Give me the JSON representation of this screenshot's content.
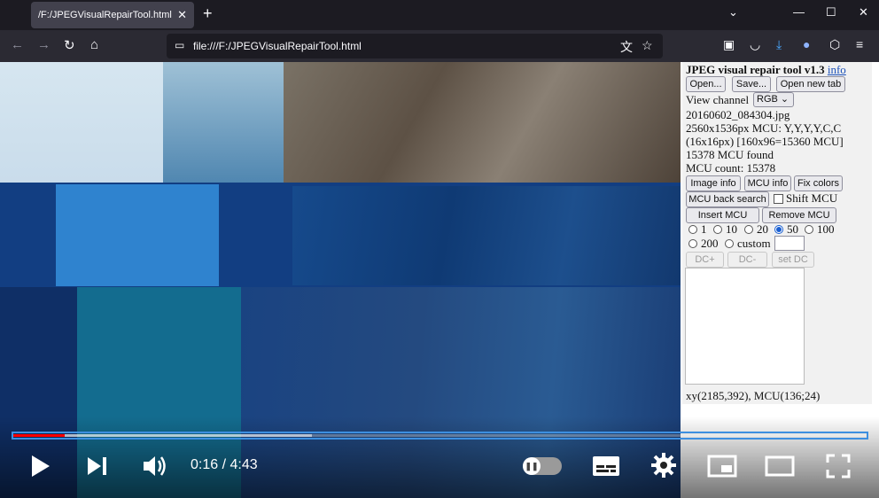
{
  "browser": {
    "tab_title": "/F:/JPEGVisualRepairTool.html",
    "url": "file:///F:/JPEGVisualRepairTool.html"
  },
  "tool": {
    "title": "JPEG visual repair tool v1.3",
    "info_link": "info",
    "open_button": "Open...",
    "save_button": "Save...",
    "open_new_tab_button": "Open new tab",
    "view_channel_label": "View channel",
    "view_channel_value": "RGB",
    "filename": "20160602_084304.jpg",
    "dims_line1": "2560x1536px MCU: Y,Y,Y,Y,C,C",
    "dims_line2": "(16x16px) [160x96=15360 MCU]",
    "mcu_found": "15378 MCU found",
    "mcu_count": "MCU count: 15378",
    "image_info_button": "Image info",
    "mcu_info_button": "MCU info",
    "fix_colors_button": "Fix colors",
    "mcu_back_search_button": "MCU back search",
    "shift_mcu_label": "Shift MCU",
    "insert_mcu_button": "Insert MCU",
    "remove_mcu_button": "Remove MCU",
    "radio_options": [
      "1",
      "10",
      "20",
      "50",
      "100",
      "200",
      "custom"
    ],
    "selected_radio": "50",
    "dc_plus_button": "DC+",
    "dc_minus_button": "DC-",
    "set_dc_button": "set DC",
    "position_readout": "xy(2185,392), MCU(136;24)"
  },
  "video": {
    "current_time": "0:16",
    "separator": " / ",
    "duration": "4:43",
    "played_fraction": 0.06,
    "buffered_fraction": 0.35
  },
  "colors": {
    "accent": "#3d8fe0",
    "progress_played": "#ff0000"
  }
}
